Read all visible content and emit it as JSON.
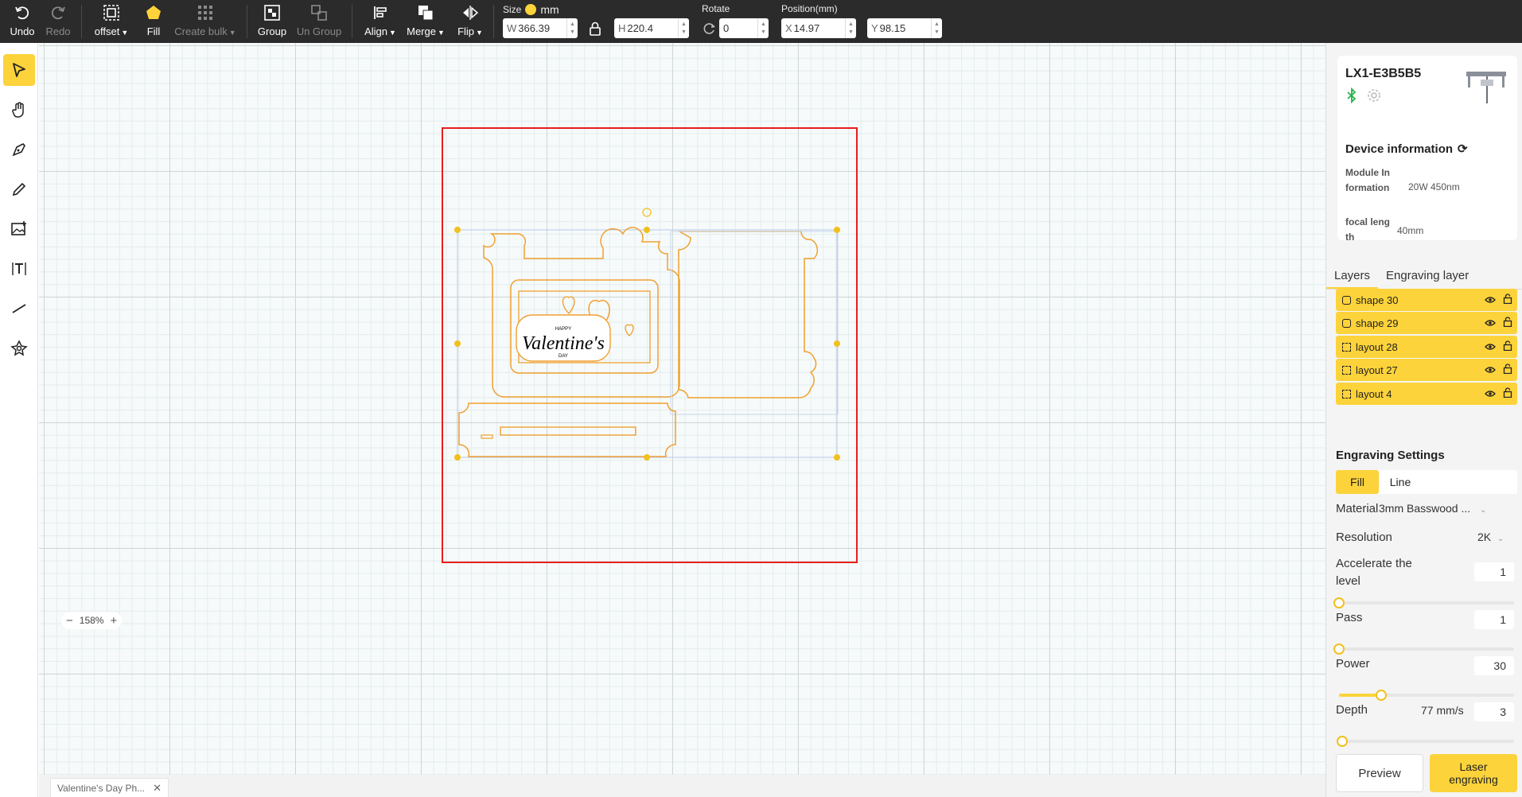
{
  "toolbar": {
    "undo": "Undo",
    "redo": "Redo",
    "offset": "offset",
    "fill": "Fill",
    "create_bulk": "Create bulk",
    "group": "Group",
    "ungroup": "Un Group",
    "align": "Align",
    "merge": "Merge",
    "flip": "Flip",
    "size_label": "Size",
    "unit": "mm",
    "width_prefix": "W",
    "width": "366.39",
    "height_prefix": "H",
    "height": "220.4",
    "rotate_label": "Rotate",
    "rotate": "0",
    "position_label": "Position(mm)",
    "x_prefix": "X",
    "x": "14.97",
    "y_prefix": "Y",
    "y": "98.15"
  },
  "left_tools": [
    "select-tool",
    "hand-tool",
    "pen-tool",
    "pencil-tool",
    "image-tool",
    "text-tool",
    "line-tool",
    "shape-tool"
  ],
  "canvas": {
    "zoom": "158%",
    "artwork_text": {
      "happy": "HAPPY",
      "main": "Valentine's",
      "day": "DAY"
    }
  },
  "document_tab": {
    "title": "Valentine's Day Ph..."
  },
  "device": {
    "name": "LX1-E3B5B5",
    "info_title": "Device information",
    "module_key": "Module Information",
    "module_value": "20W 450nm",
    "focal_key": "focal length",
    "focal_value": "40mm"
  },
  "tabs": {
    "layers": "Layers",
    "engraving_layer": "Engraving layer"
  },
  "layers": [
    {
      "name": "shape 30",
      "kind": "shape"
    },
    {
      "name": "shape 29",
      "kind": "shape"
    },
    {
      "name": "layout 28",
      "kind": "layout"
    },
    {
      "name": "layout 27",
      "kind": "layout"
    },
    {
      "name": "layout 4",
      "kind": "layout"
    }
  ],
  "engraving": {
    "title": "Engraving Settings",
    "mode_fill": "Fill",
    "mode_line": "Line",
    "material_label": "Material",
    "material_value": "3mm Basswood ...",
    "resolution_label": "Resolution",
    "resolution_value": "2K",
    "accelerate_label": "Accelerate the level",
    "accelerate_value": "1",
    "accelerate_fraction": 0,
    "pass_label": "Pass",
    "pass_value": "1",
    "pass_fraction": 0,
    "power_label": "Power",
    "power_value": "30",
    "power_fraction": 0.24,
    "depth_label": "Depth",
    "speed_value": "77 mm/s",
    "depth_value": "3",
    "depth_fraction": 0.02,
    "preview": "Preview",
    "laser": "Laser engraving"
  },
  "colors": {
    "accent": "#fcd33a",
    "toolbar_bg": "#2b2b2b",
    "workarea_border": "#e61e1e",
    "path": "#f0a030",
    "selection_handle": "#f2c01c"
  }
}
